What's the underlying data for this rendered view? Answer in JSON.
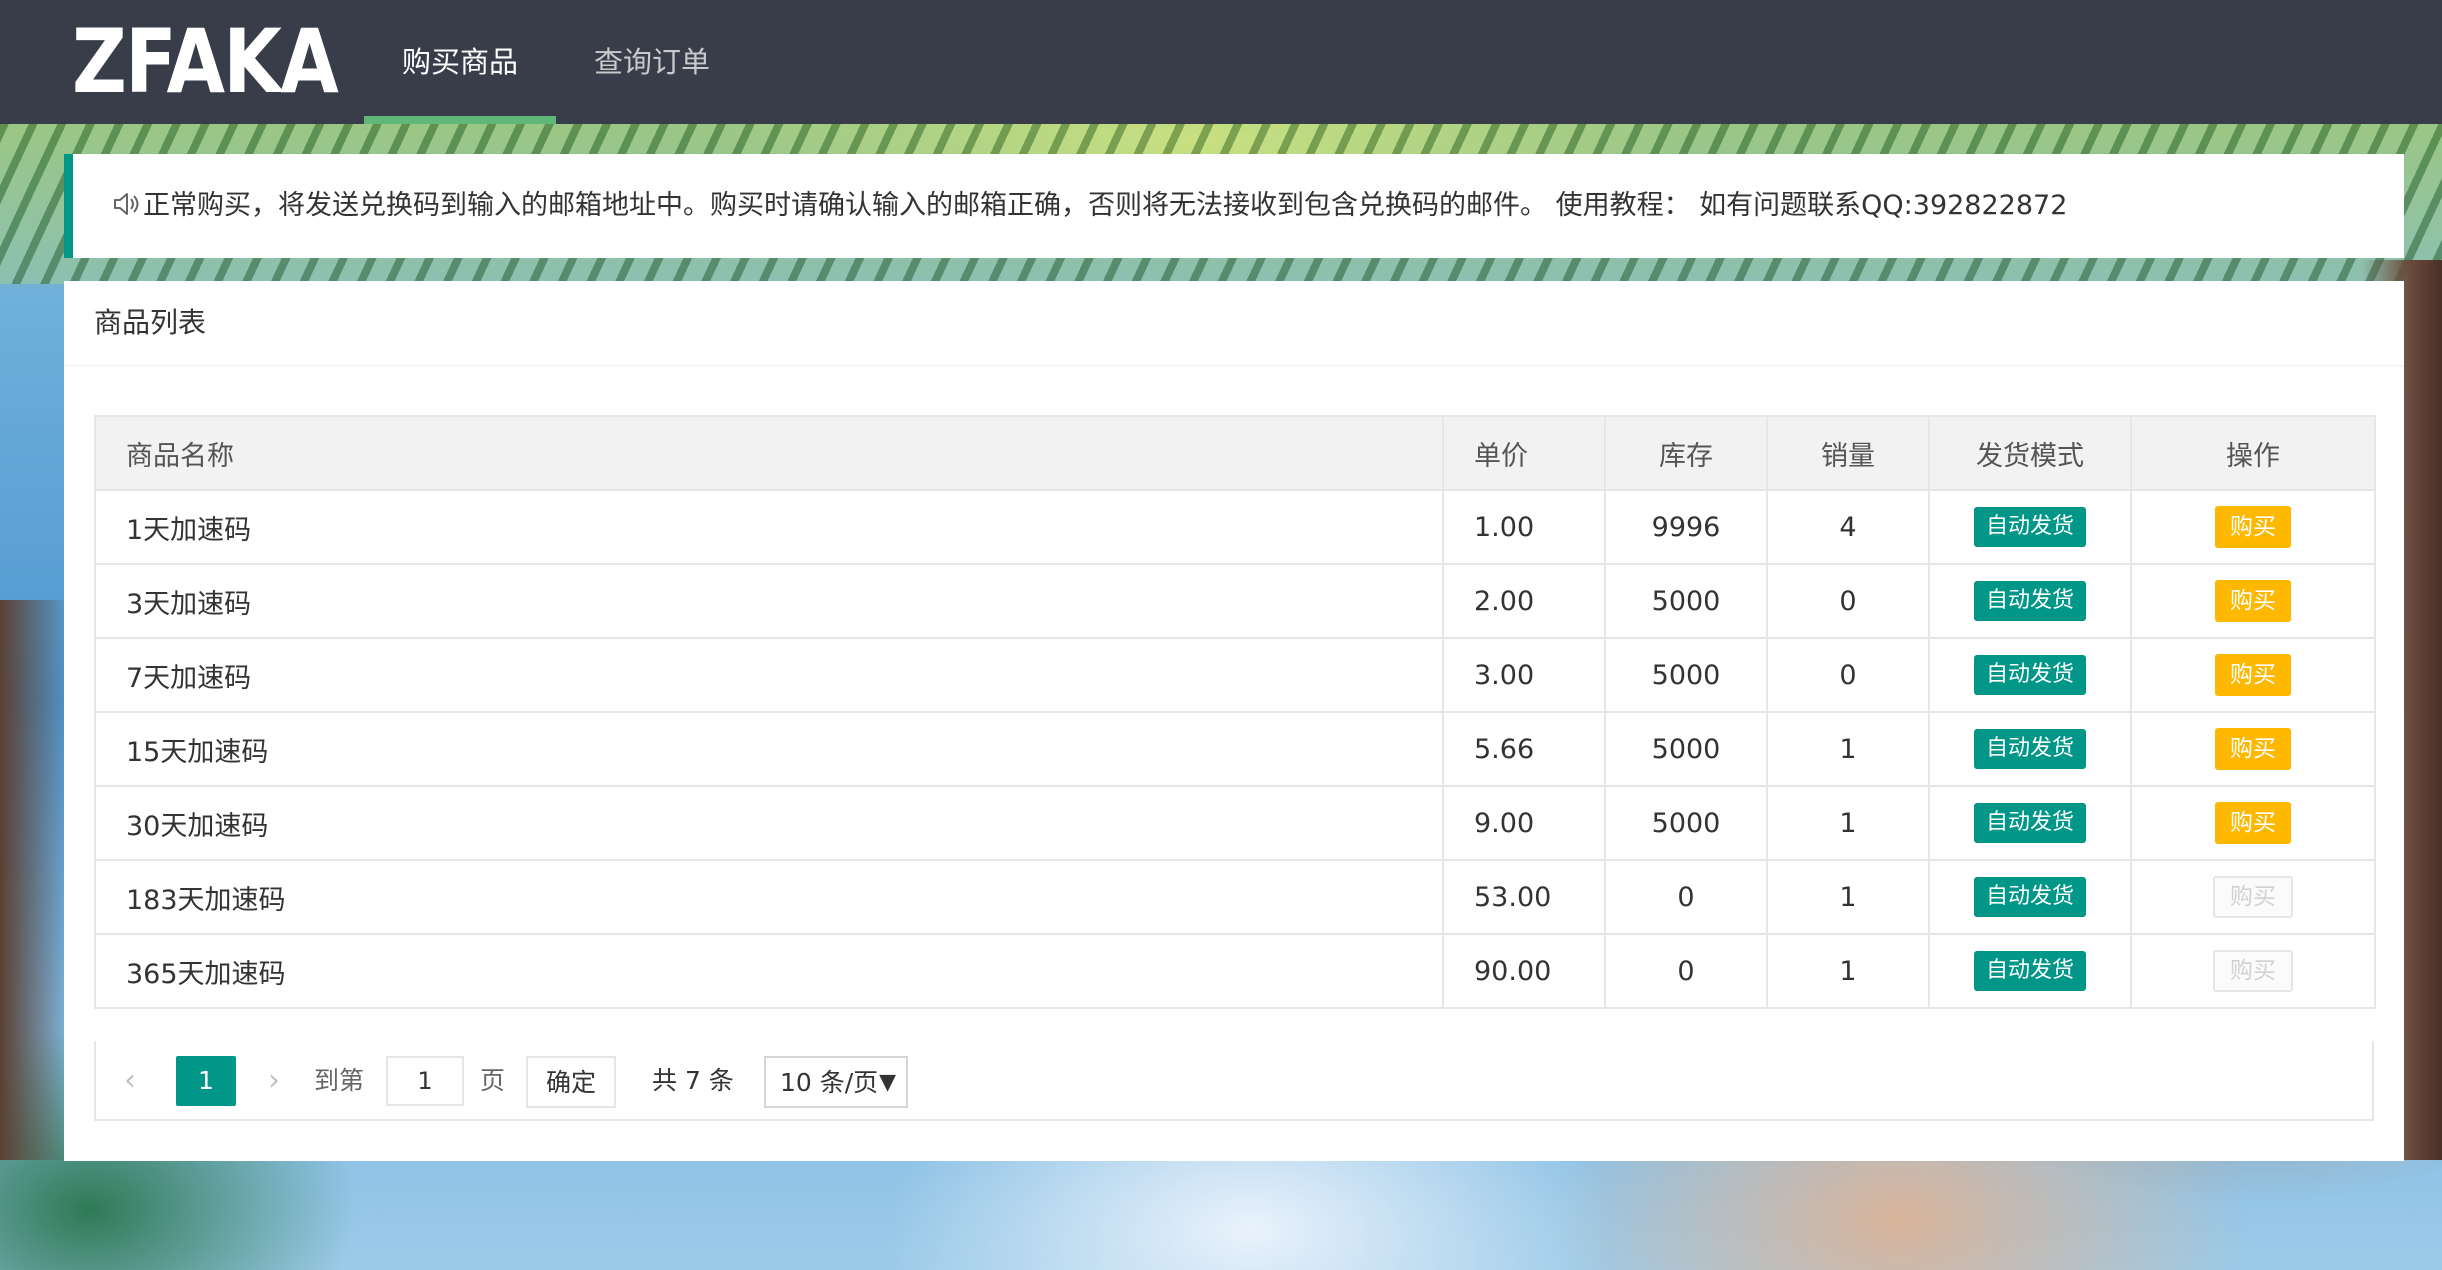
{
  "navbar": {
    "logo": "ZFAKA",
    "items": [
      {
        "label": "购买商品",
        "active": true
      },
      {
        "label": "查询订单",
        "active": false
      }
    ]
  },
  "notice": {
    "icon": "speaker-icon",
    "text": "正常购买，将发送兑换码到输入的邮箱地址中。购买时请确认输入的邮箱正确，否则将无法接收到包含兑换码的邮件。 使用教程： 如有问题联系QQ:392822872"
  },
  "card": {
    "title": "商品列表"
  },
  "table": {
    "columns": [
      "商品名称",
      "单价",
      "库存",
      "销量",
      "发货模式",
      "操作"
    ],
    "rows": [
      {
        "name": "1天加速码",
        "price": "1.00",
        "stock": "9996",
        "sold": "4",
        "mode": "自动发货",
        "action": "购买",
        "enabled": true
      },
      {
        "name": "3天加速码",
        "price": "2.00",
        "stock": "5000",
        "sold": "0",
        "mode": "自动发货",
        "action": "购买",
        "enabled": true
      },
      {
        "name": "7天加速码",
        "price": "3.00",
        "stock": "5000",
        "sold": "0",
        "mode": "自动发货",
        "action": "购买",
        "enabled": true
      },
      {
        "name": "15天加速码",
        "price": "5.66",
        "stock": "5000",
        "sold": "1",
        "mode": "自动发货",
        "action": "购买",
        "enabled": true
      },
      {
        "name": "30天加速码",
        "price": "9.00",
        "stock": "5000",
        "sold": "1",
        "mode": "自动发货",
        "action": "购买",
        "enabled": true
      },
      {
        "name": "183天加速码",
        "price": "53.00",
        "stock": "0",
        "sold": "1",
        "mode": "自动发货",
        "action": "购买",
        "enabled": false
      },
      {
        "name": "365天加速码",
        "price": "90.00",
        "stock": "0",
        "sold": "1",
        "mode": "自动发货",
        "action": "购买",
        "enabled": false
      }
    ]
  },
  "pagination": {
    "current_page": "1",
    "goto_label": "到第",
    "goto_value": "1",
    "page_label": "页",
    "confirm_label": "确定",
    "total_label": "共 7 条",
    "page_size": "10 条/页"
  },
  "colors": {
    "navbar": "#393d49",
    "accent": "#009688",
    "nav_active_bar": "#5fb878",
    "buy_button": "#ffb800"
  }
}
